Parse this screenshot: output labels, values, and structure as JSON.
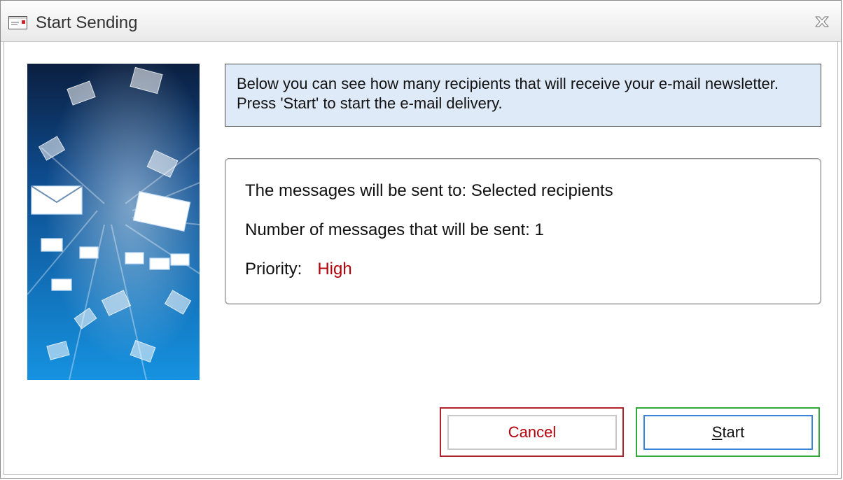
{
  "window": {
    "title": "Start Sending"
  },
  "info": {
    "text": "Below you can see how many recipients that will receive your e-mail newsletter. Press 'Start' to start the e-mail delivery."
  },
  "details": {
    "recipients_line": "The messages will be sent to: Selected recipients",
    "count_line": "Number of messages that will be sent: 1",
    "priority_label": "Priority:",
    "priority_value": "High"
  },
  "buttons": {
    "cancel_label": "Cancel",
    "start_mnemonic": "S",
    "start_rest": "tart"
  },
  "icons": {
    "title": "envelope-icon",
    "close": "close-icon",
    "side_image": "flying-envelopes-image"
  },
  "colors": {
    "priority": "#b3000b",
    "cancel_text": "#b3000b",
    "cancel_frame": "#b0232b",
    "start_frame": "#30a838",
    "start_border": "#3b86d8",
    "info_background": "#dfeaf8"
  }
}
